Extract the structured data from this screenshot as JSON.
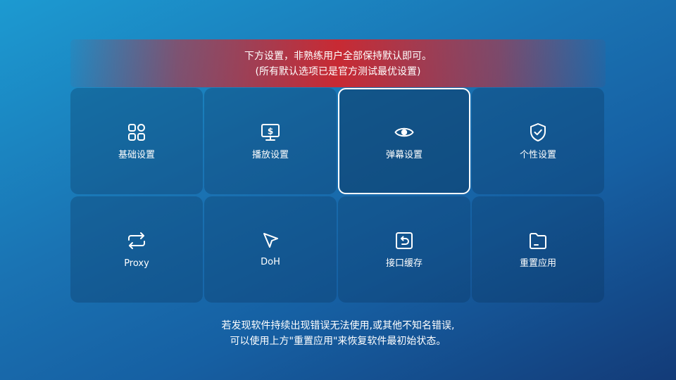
{
  "banner": {
    "line1": "下方设置，非熟练用户全部保持默认即可。",
    "line2": "(所有默认选项已是官方测试最优设置)"
  },
  "tiles": [
    {
      "label": "基础设置",
      "icon": "grid-icon"
    },
    {
      "label": "播放设置",
      "icon": "monitor-dollar-icon"
    },
    {
      "label": "弹幕设置",
      "icon": "eye-icon",
      "focused": true
    },
    {
      "label": "个性设置",
      "icon": "shield-check-icon"
    },
    {
      "label": "Proxy",
      "icon": "repeat-icon"
    },
    {
      "label": "DoH",
      "icon": "cursor-icon"
    },
    {
      "label": "接口缓存",
      "icon": "undo-box-icon"
    },
    {
      "label": "重置应用",
      "icon": "folder-icon"
    }
  ],
  "notice": {
    "line1": "若发现软件持续出现错误无法使用,或其他不知名错误,",
    "line2": "可以使用上方\"重置应用\"来恢复软件最初始状态。"
  },
  "colors": {
    "background_top": "#1c9ad1",
    "background_bottom": "#133b78",
    "banner_red": "#d72328",
    "tile_focus_border": "#ffffff"
  }
}
